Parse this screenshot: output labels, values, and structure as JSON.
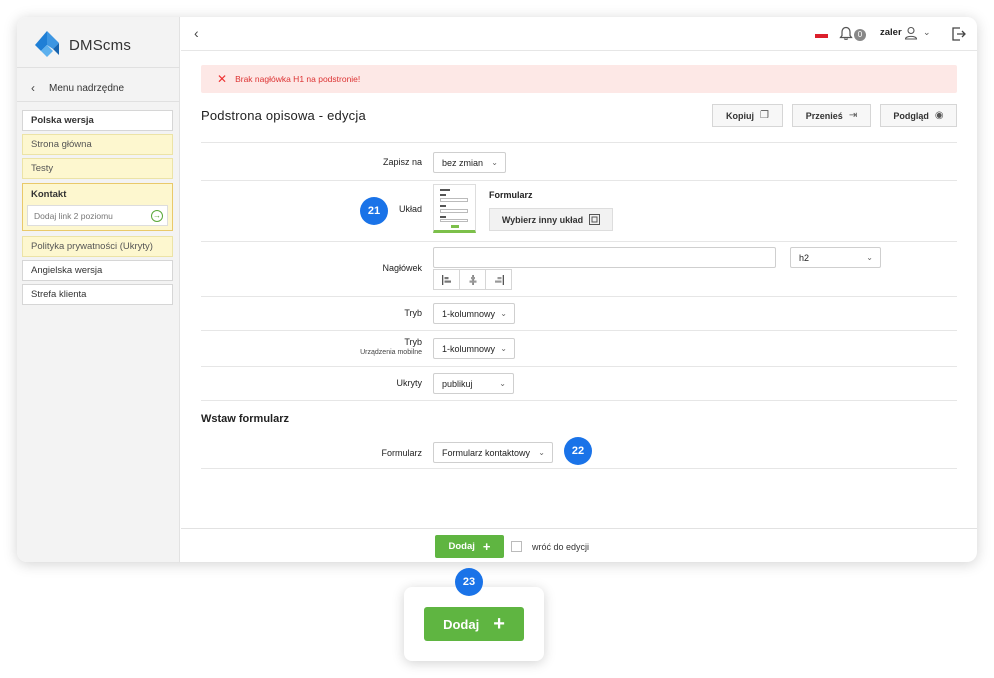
{
  "app": {
    "name": "DMScms"
  },
  "sidebar": {
    "parent_menu_label": "Menu nadrzędne",
    "items": [
      {
        "label": "Polska wersja",
        "style": "bold"
      },
      {
        "label": "Strona główna",
        "style": "yellow"
      },
      {
        "label": "Testy",
        "style": "yellow"
      },
      {
        "label": "Kontakt",
        "style": "group",
        "sub_placeholder": "Dodaj link 2 poziomu"
      },
      {
        "label": "Polityka prywatności (Ukryty)",
        "style": "yellow"
      },
      {
        "label": "Angielska wersja",
        "style": "plain"
      },
      {
        "label": "Strefa klienta",
        "style": "plain"
      }
    ]
  },
  "topbar": {
    "notifications_count": "0",
    "user_name": "zaler"
  },
  "alert": {
    "message": "Brak nagłówka H1 na podstronie!"
  },
  "page": {
    "title": "Podstrona opisowa - edycja",
    "actions": {
      "copy": "Kopiuj",
      "move": "Przenieś",
      "preview": "Podgląd"
    }
  },
  "form": {
    "save_to": {
      "label": "Zapisz na",
      "value": "bez zmian"
    },
    "layout": {
      "label": "Układ",
      "name": "Formularz",
      "choose_button": "Wybierz inny układ"
    },
    "heading": {
      "label": "Nagłówek",
      "value": "",
      "level": "h2"
    },
    "mode": {
      "label": "Tryb",
      "value": "1-kolumnowy"
    },
    "mode_mobile": {
      "label": "Tryb",
      "sublabel": "Urządzenia mobilne",
      "value": "1-kolumnowy"
    },
    "hidden": {
      "label": "Ukryty",
      "value": "publikuj"
    },
    "insert_form_section": "Wstaw formularz",
    "form_select": {
      "label": "Formularz",
      "value": "Formularz kontaktowy"
    }
  },
  "footer": {
    "add_button": "Dodaj",
    "back_to_edit": "wróć do edycji"
  },
  "badges": {
    "b21": "21",
    "b22": "22",
    "b23": "23"
  },
  "zoom": {
    "add_button": "Dodaj"
  },
  "colors": {
    "accent_green": "#5fb541",
    "badge_blue": "#1a73e8",
    "alert_red": "#dd3333"
  }
}
